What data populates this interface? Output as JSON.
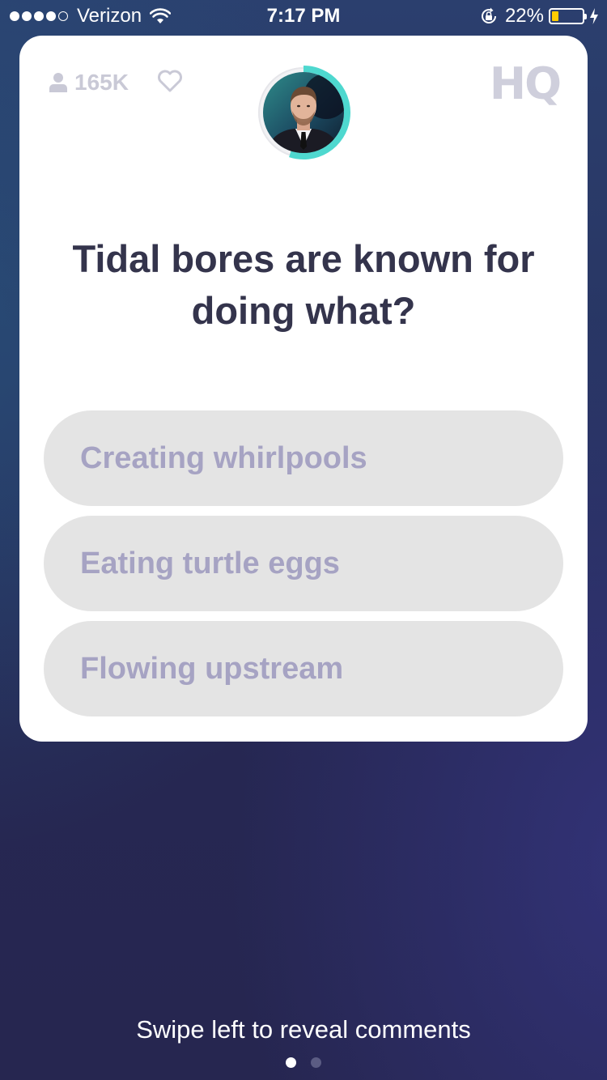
{
  "status_bar": {
    "carrier": "Verizon",
    "signal_bars_filled": 4,
    "signal_bars_total": 5,
    "time": "7:17 PM",
    "battery_percent_label": "22%",
    "battery_level": 0.22,
    "battery_color": "#ffcc00"
  },
  "header": {
    "viewer_count": "165K",
    "logo": "HQ"
  },
  "host": {
    "timer_fraction_remaining": 0.55,
    "timer_color": "#4ed8cf"
  },
  "question": {
    "text": "Tidal bores are known for doing what?"
  },
  "answers": [
    {
      "label": "Creating whirlpools"
    },
    {
      "label": "Eating turtle eggs"
    },
    {
      "label": "Flowing upstream"
    }
  ],
  "footer": {
    "hint": "Swipe left to reveal comments",
    "pages_total": 2,
    "page_active": 1
  },
  "colors": {
    "question_text": "#34344c",
    "answer_bg": "#e4e4e4",
    "answer_text": "#a6a3c3",
    "background_top": "#2b3f6e",
    "background_bottom": "#262650"
  }
}
